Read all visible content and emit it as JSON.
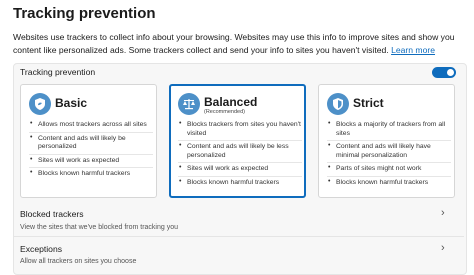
{
  "page": {
    "title": "Tracking prevention",
    "intro": "Websites use trackers to collect info about your browsing. Websites may use this info to improve sites and show you content like personalized ads. Some trackers collect and send your info to sites you haven't visited.",
    "learn_more": "Learn more"
  },
  "section": {
    "label": "Tracking prevention",
    "toggle_on": true
  },
  "cards": [
    {
      "title": "Basic",
      "subtitle": "",
      "icon": "shield-basic-icon",
      "items": [
        "Allows most trackers across all sites",
        "Content and ads will likely be personalized",
        "Sites will work as expected",
        "Blocks known harmful trackers"
      ]
    },
    {
      "title": "Balanced",
      "subtitle": "(Recommended)",
      "icon": "scale-icon",
      "items": [
        "Blocks trackers from sites you haven't visited",
        "Content and ads will likely be less personalized",
        "Sites will work as expected",
        "Blocks known harmful trackers"
      ]
    },
    {
      "title": "Strict",
      "subtitle": "",
      "icon": "shield-strict-icon",
      "items": [
        "Blocks a majority of trackers from all sites",
        "Content and ads will likely have minimal personalization",
        "Parts of sites might not work",
        "Blocks known harmful trackers"
      ]
    }
  ],
  "rows": {
    "blocked": {
      "title": "Blocked trackers",
      "sub": "View the sites that we've blocked from tracking you"
    },
    "exceptions": {
      "title": "Exceptions",
      "sub": "Allow all trackers on sites you choose"
    }
  },
  "colors": {
    "accent": "#0f6cbd",
    "icon_bg": "#4d90c8"
  }
}
